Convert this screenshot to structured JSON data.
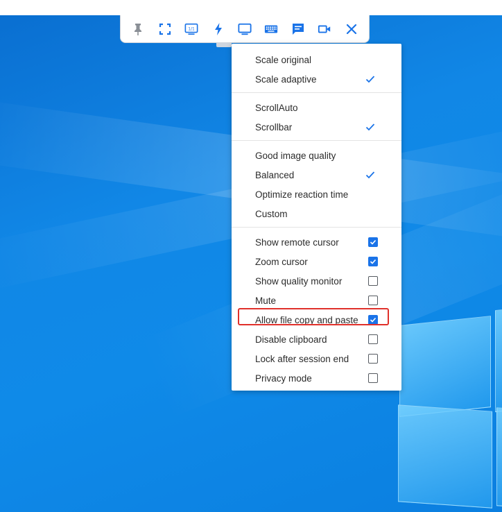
{
  "toolbar": {
    "buttons": [
      {
        "name": "pin-icon"
      },
      {
        "name": "fullscreen-icon"
      },
      {
        "name": "original-size-icon",
        "text": "1/1"
      },
      {
        "name": "lightning-icon"
      },
      {
        "name": "display-icon"
      },
      {
        "name": "keyboard-icon"
      },
      {
        "name": "chat-icon"
      },
      {
        "name": "video-camera-icon"
      },
      {
        "name": "close-icon"
      }
    ],
    "accent": "#1a73e8",
    "muted": "#8a8f96"
  },
  "menu": {
    "groups": [
      {
        "items": [
          {
            "label": "Scale original",
            "checked": false
          },
          {
            "label": "Scale adaptive",
            "checked": true
          }
        ]
      },
      {
        "items": [
          {
            "label": "ScrollAuto",
            "checked": false
          },
          {
            "label": "Scrollbar",
            "checked": true
          }
        ]
      },
      {
        "items": [
          {
            "label": "Good image quality",
            "checked": false
          },
          {
            "label": "Balanced",
            "checked": true
          },
          {
            "label": "Optimize reaction time",
            "checked": false
          },
          {
            "label": "Custom",
            "checked": false
          }
        ]
      },
      {
        "type": "checkbox",
        "items": [
          {
            "label": "Show remote cursor",
            "checked": true
          },
          {
            "label": "Zoom cursor",
            "checked": true
          },
          {
            "label": "Show quality monitor",
            "checked": false
          },
          {
            "label": "Mute",
            "checked": false
          },
          {
            "label": "Allow file copy and paste",
            "checked": true,
            "highlighted": true
          },
          {
            "label": "Disable clipboard",
            "checked": false
          },
          {
            "label": "Lock after session end",
            "checked": false
          },
          {
            "label": "Privacy mode",
            "checked": false
          }
        ]
      }
    ]
  },
  "colors": {
    "highlight_border": "#e0302a",
    "checkbox_on": "#1a73e8"
  }
}
